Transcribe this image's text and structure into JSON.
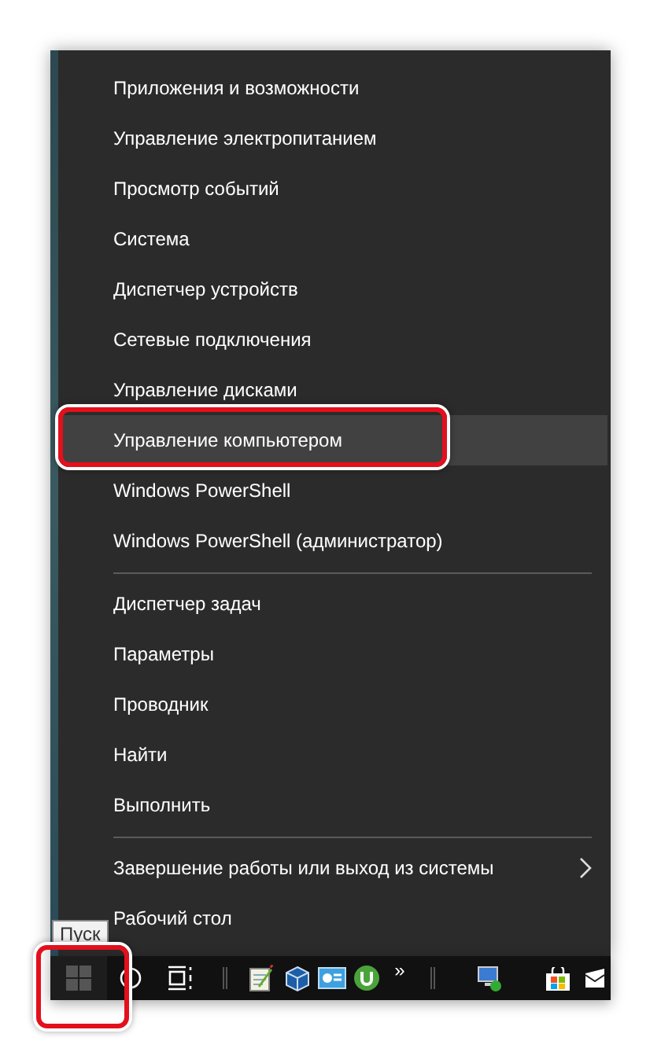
{
  "menu": {
    "groups": [
      {
        "items": [
          {
            "label": "Приложения и возможности",
            "selected": false,
            "annotated": false,
            "submenu": false
          },
          {
            "label": "Управление электропитанием",
            "selected": false,
            "annotated": false,
            "submenu": false
          },
          {
            "label": "Просмотр событий",
            "selected": false,
            "annotated": false,
            "submenu": false
          },
          {
            "label": "Система",
            "selected": false,
            "annotated": false,
            "submenu": false
          },
          {
            "label": "Диспетчер устройств",
            "selected": false,
            "annotated": false,
            "submenu": false
          },
          {
            "label": "Сетевые подключения",
            "selected": false,
            "annotated": false,
            "submenu": false
          },
          {
            "label": "Управление дисками",
            "selected": false,
            "annotated": false,
            "submenu": false
          },
          {
            "label": "Управление компьютером",
            "selected": true,
            "annotated": true,
            "submenu": false
          },
          {
            "label": "Windows PowerShell",
            "selected": false,
            "annotated": false,
            "submenu": false
          },
          {
            "label": "Windows PowerShell (администратор)",
            "selected": false,
            "annotated": false,
            "submenu": false
          }
        ]
      },
      {
        "items": [
          {
            "label": "Диспетчер задач",
            "selected": false,
            "annotated": false,
            "submenu": false
          },
          {
            "label": "Параметры",
            "selected": false,
            "annotated": false,
            "submenu": false
          },
          {
            "label": "Проводник",
            "selected": false,
            "annotated": false,
            "submenu": false
          },
          {
            "label": "Найти",
            "selected": false,
            "annotated": false,
            "submenu": false
          },
          {
            "label": "Выполнить",
            "selected": false,
            "annotated": false,
            "submenu": false
          }
        ]
      },
      {
        "items": [
          {
            "label": "Завершение работы или выход из системы",
            "selected": false,
            "annotated": false,
            "submenu": true
          },
          {
            "label": "Рабочий стол",
            "selected": false,
            "annotated": false,
            "submenu": false
          }
        ]
      }
    ]
  },
  "tooltip": "Пуск",
  "taskbar": {
    "items": [
      {
        "kind": "start",
        "annotated": true
      },
      {
        "kind": "search"
      },
      {
        "kind": "taskview"
      },
      {
        "kind": "divider"
      },
      {
        "kind": "notepad"
      },
      {
        "kind": "cube"
      },
      {
        "kind": "card"
      },
      {
        "kind": "torrent"
      },
      {
        "kind": "overflow",
        "label": "»"
      },
      {
        "kind": "divider"
      },
      {
        "kind": "network"
      },
      {
        "kind": "store"
      },
      {
        "kind": "mail"
      }
    ]
  }
}
